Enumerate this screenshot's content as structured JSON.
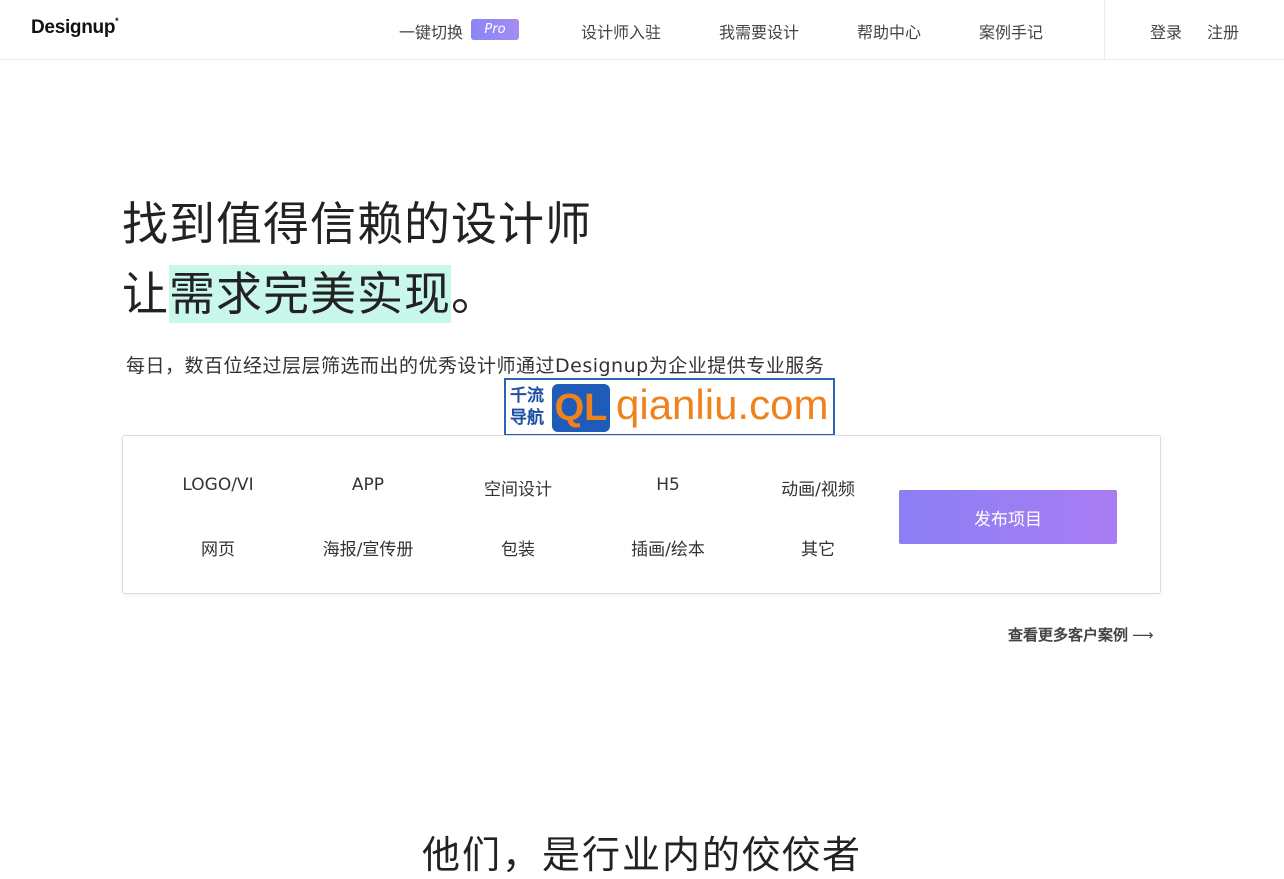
{
  "header": {
    "logo": "Designup",
    "logo_mark": "*",
    "nav": [
      {
        "label": "一键切换"
      },
      {
        "label": "设计师入驻"
      },
      {
        "label": "我需要设计"
      },
      {
        "label": "帮助中心"
      },
      {
        "label": "案例手记"
      }
    ],
    "pro_badge": "Pro",
    "login": "登录",
    "register": "注册"
  },
  "hero": {
    "line1": "找到值得信赖的设计师",
    "line2_prefix": "让",
    "line2_highlight": "需求完美实现",
    "line2_suffix": "。",
    "subtitle": "每日，数百位经过层层筛选而出的优秀设计师通过Designup为企业提供专业服务"
  },
  "watermark": {
    "cn_top": "千流",
    "cn_bottom": "导航",
    "badge": "QL",
    "domain": "qianliu.com"
  },
  "categories": {
    "row1": [
      "LOGO/VI",
      "APP",
      "空间设计",
      "H5",
      "动画/视频"
    ],
    "row2": [
      "网页",
      "海报/宣传册",
      "包装",
      "插画/绘本",
      "其它"
    ]
  },
  "publish_button": "发布项目",
  "more_cases": "查看更多客户案例",
  "more_cases_arrow": "⟶",
  "section_title": "他们，是行业内的佼佼者",
  "colors": {
    "accent_start": "#8b7ff4",
    "accent_end": "#a97cf3",
    "highlight": "#c9f7ec"
  }
}
